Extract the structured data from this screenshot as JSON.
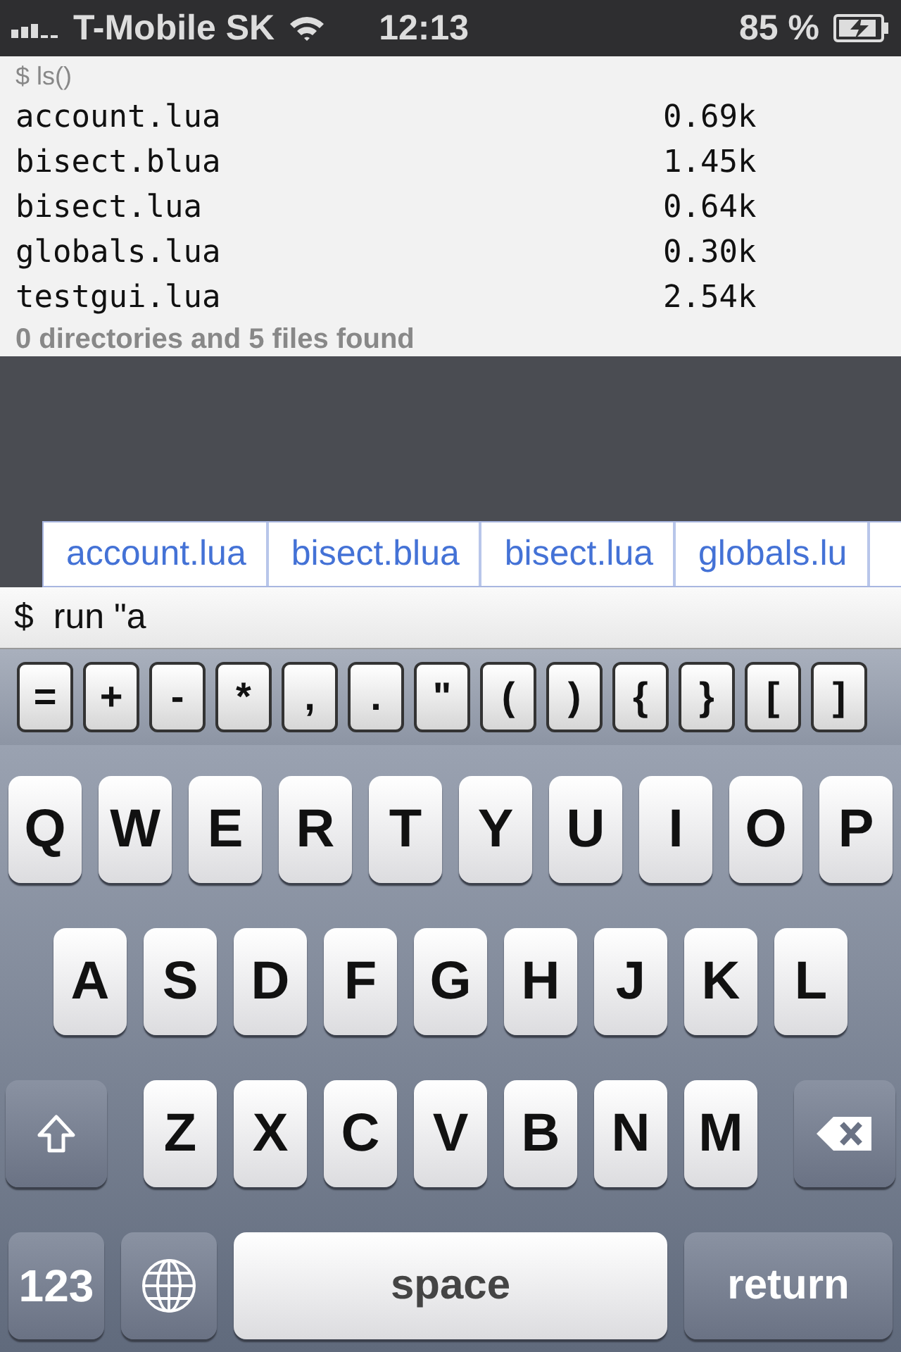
{
  "status_bar": {
    "carrier": "T-Mobile SK",
    "time": "12:13",
    "battery": "85 %"
  },
  "console": {
    "command": "$ ls()",
    "files": [
      {
        "name": "account.lua",
        "size": "0.69k"
      },
      {
        "name": "bisect.blua",
        "size": "1.45k"
      },
      {
        "name": "bisect.lua",
        "size": "0.64k"
      },
      {
        "name": "globals.lua",
        "size": "0.30k"
      },
      {
        "name": "testgui.lua",
        "size": "2.54k"
      }
    ],
    "summary": "0 directories and 5 files found"
  },
  "completions": [
    "account.lua",
    "bisect.blua",
    "bisect.lua",
    "globals.lu"
  ],
  "input": {
    "prompt": "$",
    "value": "run \"a"
  },
  "symbol_keys": [
    "=",
    "+",
    "-",
    "*",
    ",",
    ".",
    "\"",
    "(",
    ")",
    "{",
    "}",
    "[",
    "]"
  ],
  "keyboard": [
    [
      {
        "kind": "letter",
        "label": "Q"
      },
      {
        "kind": "letter",
        "label": "W"
      },
      {
        "kind": "letter",
        "label": "E"
      },
      {
        "kind": "letter",
        "label": "R"
      },
      {
        "kind": "letter",
        "label": "T"
      },
      {
        "kind": "letter",
        "label": "Y"
      },
      {
        "kind": "letter",
        "label": "U"
      },
      {
        "kind": "letter",
        "label": "I"
      },
      {
        "kind": "letter",
        "label": "O"
      },
      {
        "kind": "letter",
        "label": "P"
      }
    ],
    [
      {
        "kind": "letter",
        "label": "A"
      },
      {
        "kind": "letter",
        "label": "S"
      },
      {
        "kind": "letter",
        "label": "D"
      },
      {
        "kind": "letter",
        "label": "F"
      },
      {
        "kind": "letter",
        "label": "G"
      },
      {
        "kind": "letter",
        "label": "H"
      },
      {
        "kind": "letter",
        "label": "J"
      },
      {
        "kind": "letter",
        "label": "K"
      },
      {
        "kind": "letter",
        "label": "L"
      }
    ],
    [
      {
        "kind": "shift"
      },
      {
        "kind": "letter",
        "label": "Z"
      },
      {
        "kind": "letter",
        "label": "X"
      },
      {
        "kind": "letter",
        "label": "C"
      },
      {
        "kind": "letter",
        "label": "V"
      },
      {
        "kind": "letter",
        "label": "B"
      },
      {
        "kind": "letter",
        "label": "N"
      },
      {
        "kind": "letter",
        "label": "M"
      },
      {
        "kind": "delete"
      }
    ],
    [
      {
        "kind": "mode",
        "label": "123"
      },
      {
        "kind": "globe"
      },
      {
        "kind": "space",
        "label": "space"
      },
      {
        "kind": "return",
        "label": "return"
      }
    ]
  ]
}
